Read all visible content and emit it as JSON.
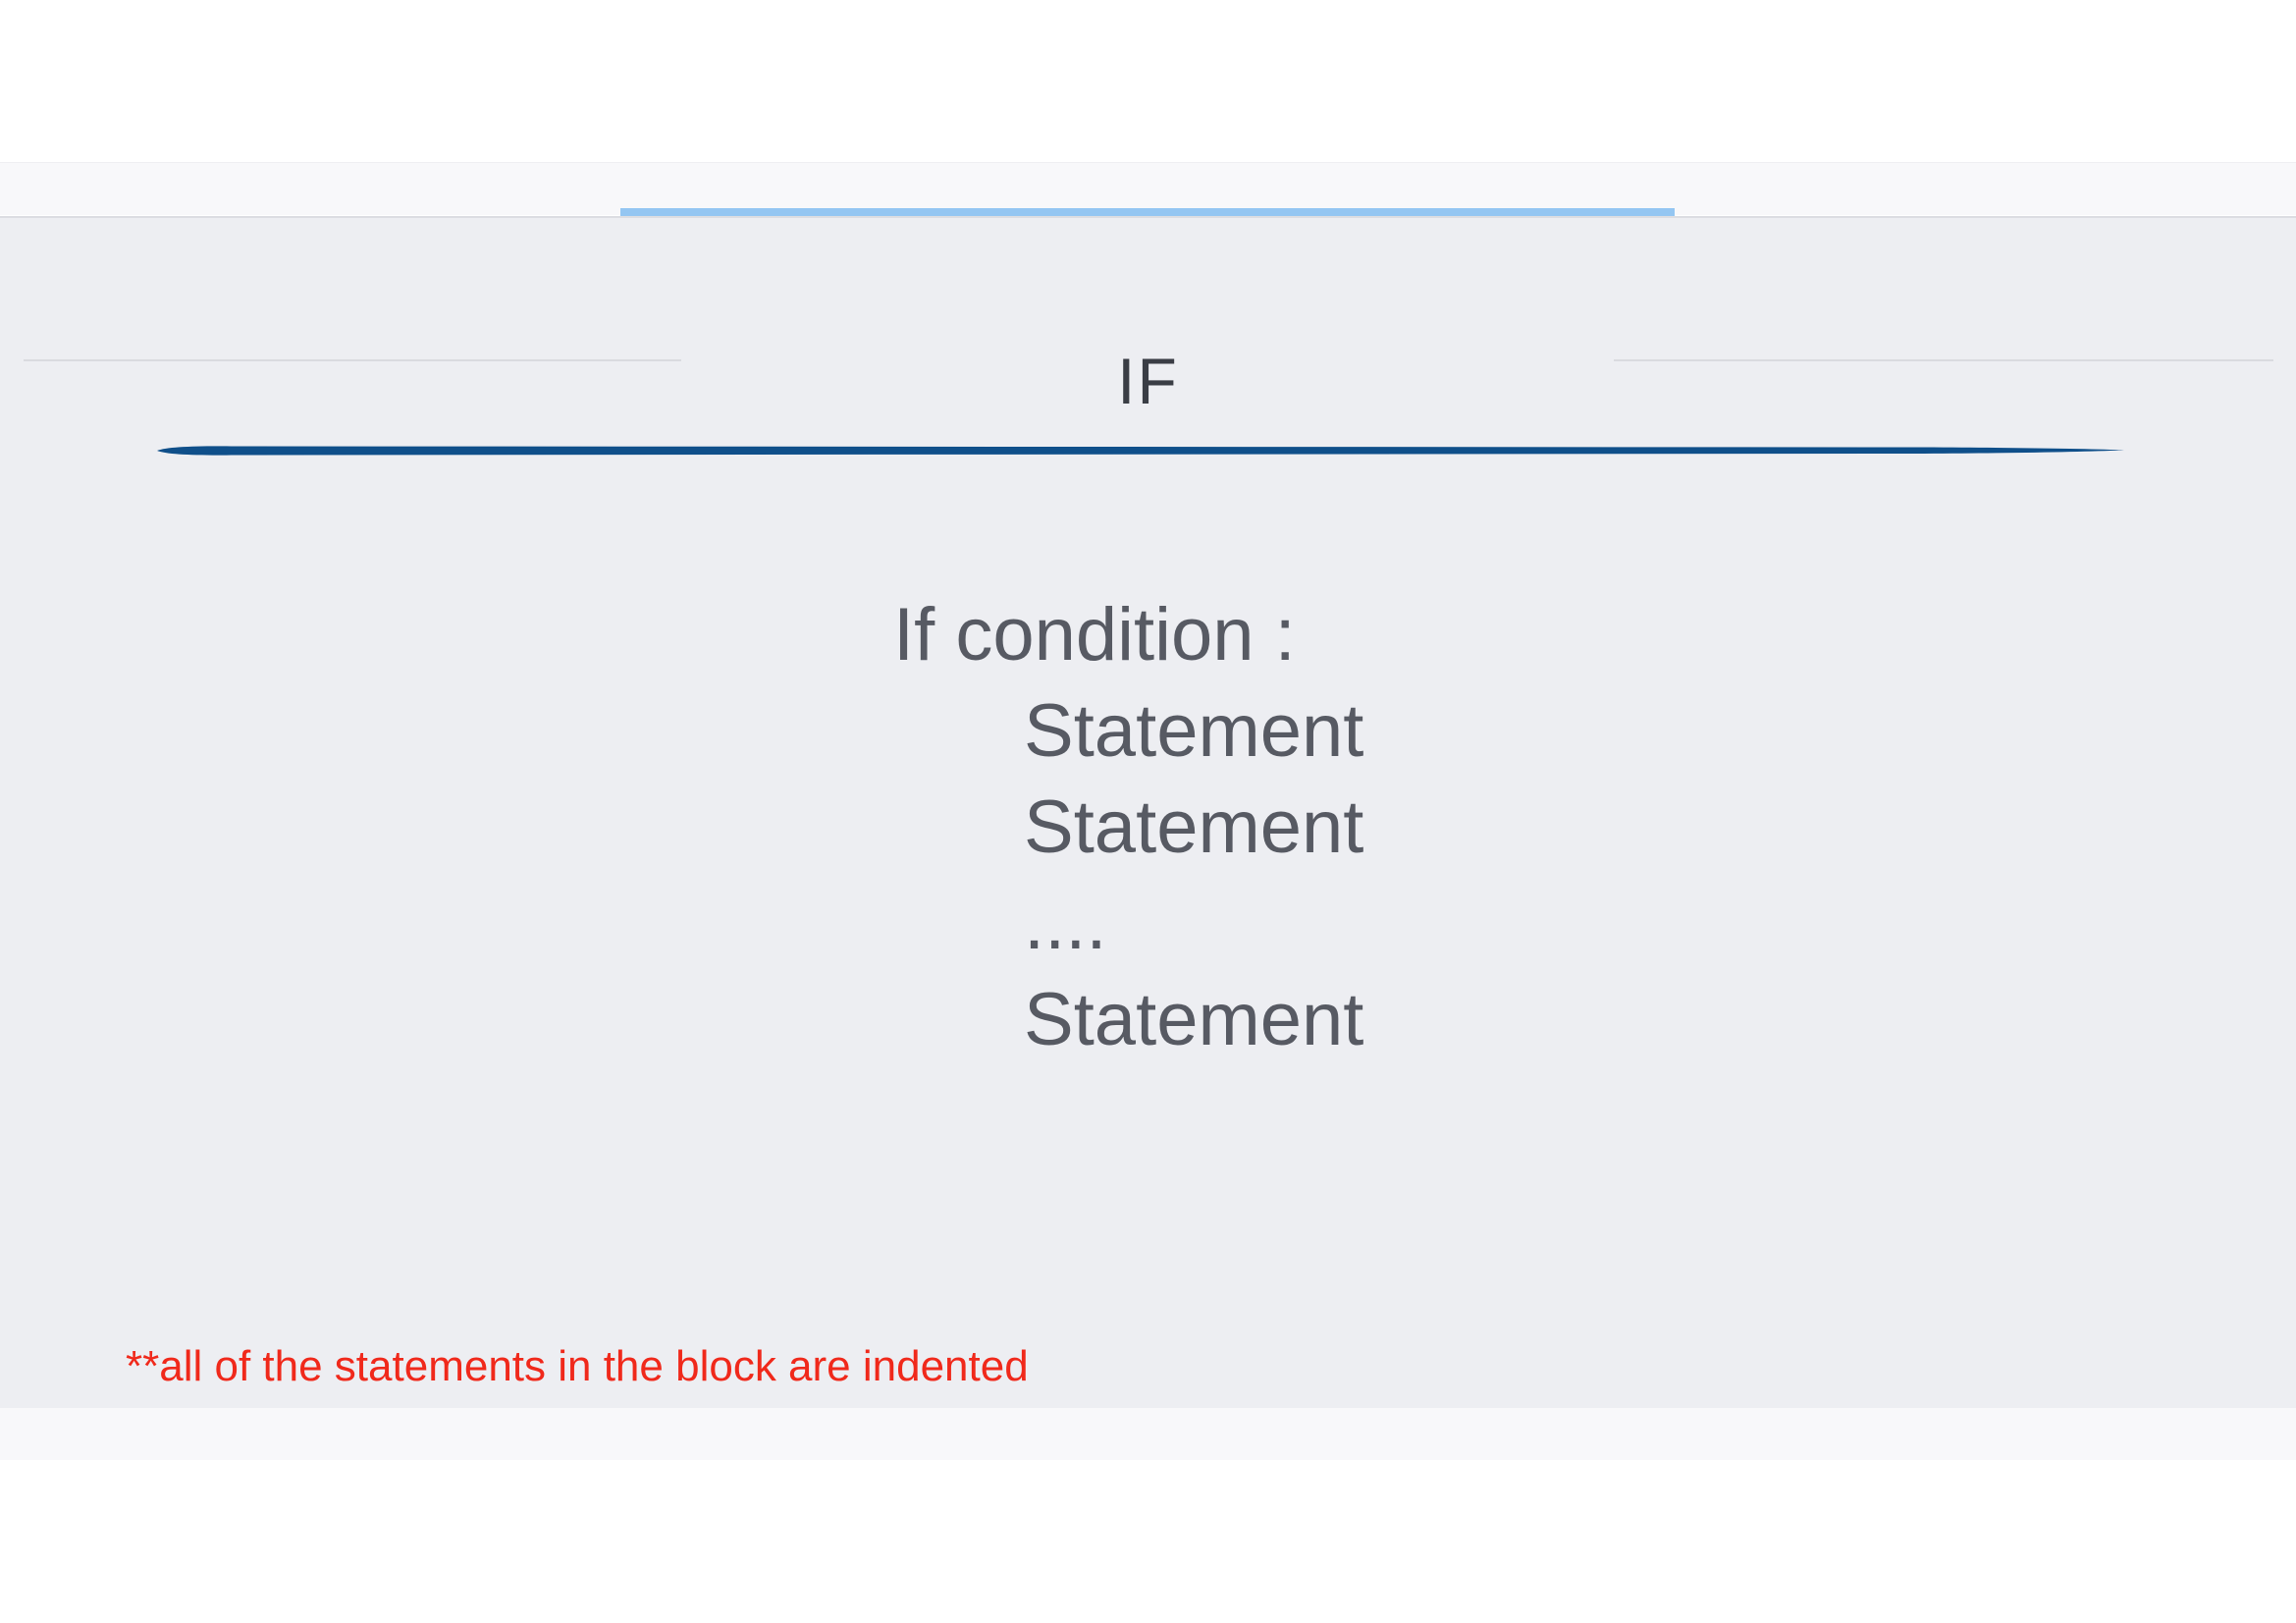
{
  "slide": {
    "title": "IF",
    "code_lines": [
      "If condition :",
      "Statement",
      "Statement",
      "....",
      "Statement"
    ],
    "footnote": "**all of the statements in the block are indented"
  },
  "colors": {
    "accent": "#94c6f2",
    "underline": "#0f4f8a",
    "footnote": "#f0291b",
    "body_text": "#575a63",
    "background": "#edeef2"
  }
}
